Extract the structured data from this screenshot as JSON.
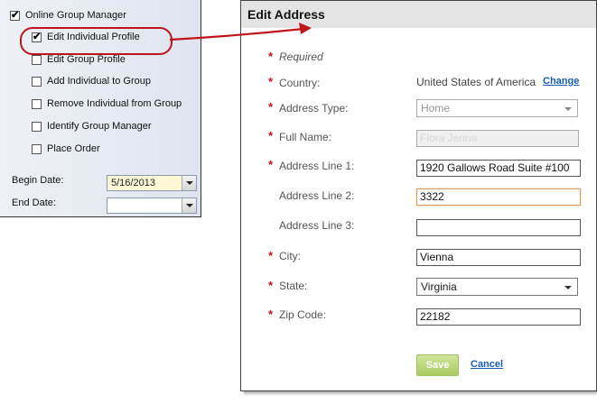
{
  "left_panel": {
    "root_item": {
      "label": "Online Group Manager",
      "checked": true
    },
    "items": [
      {
        "label": "Edit Individual Profile",
        "checked": true
      },
      {
        "label": "Edit Group Profile",
        "checked": false
      },
      {
        "label": "Add Individual to Group",
        "checked": false
      },
      {
        "label": "Remove Individual from Group",
        "checked": false
      },
      {
        "label": "Identify Group Manager",
        "checked": false
      },
      {
        "label": "Place Order",
        "checked": false
      }
    ],
    "begin_date": {
      "label": "Begin Date:",
      "value": "5/16/2013"
    },
    "end_date": {
      "label": "End Date:",
      "value": ""
    }
  },
  "edit_address": {
    "title": "Edit Address",
    "required_note": "Required",
    "country": {
      "label": "Country:",
      "value": "United States of America",
      "change_link": "Change"
    },
    "address_type": {
      "label": "Address Type:",
      "value": "Home"
    },
    "full_name": {
      "label": "Full Name:",
      "value": "Flora Jenna"
    },
    "address_line_1": {
      "label": "Address Line 1:",
      "value": "1920 Gallows Road Suite #100"
    },
    "address_line_2": {
      "label": "Address Line 2:",
      "value": "3322"
    },
    "address_line_3": {
      "label": "Address Line 3:",
      "value": ""
    },
    "city": {
      "label": "City:",
      "value": "Vienna"
    },
    "state": {
      "label": "State:",
      "value": "Virginia"
    },
    "zip": {
      "label": "Zip Code:",
      "value": "22182"
    },
    "save_label": "Save",
    "cancel_label": "Cancel"
  },
  "colors": {
    "required_star": "#c0141c",
    "link": "#1a5bb5",
    "save_button": "#a9cc62",
    "annotation": "#c0141c"
  }
}
